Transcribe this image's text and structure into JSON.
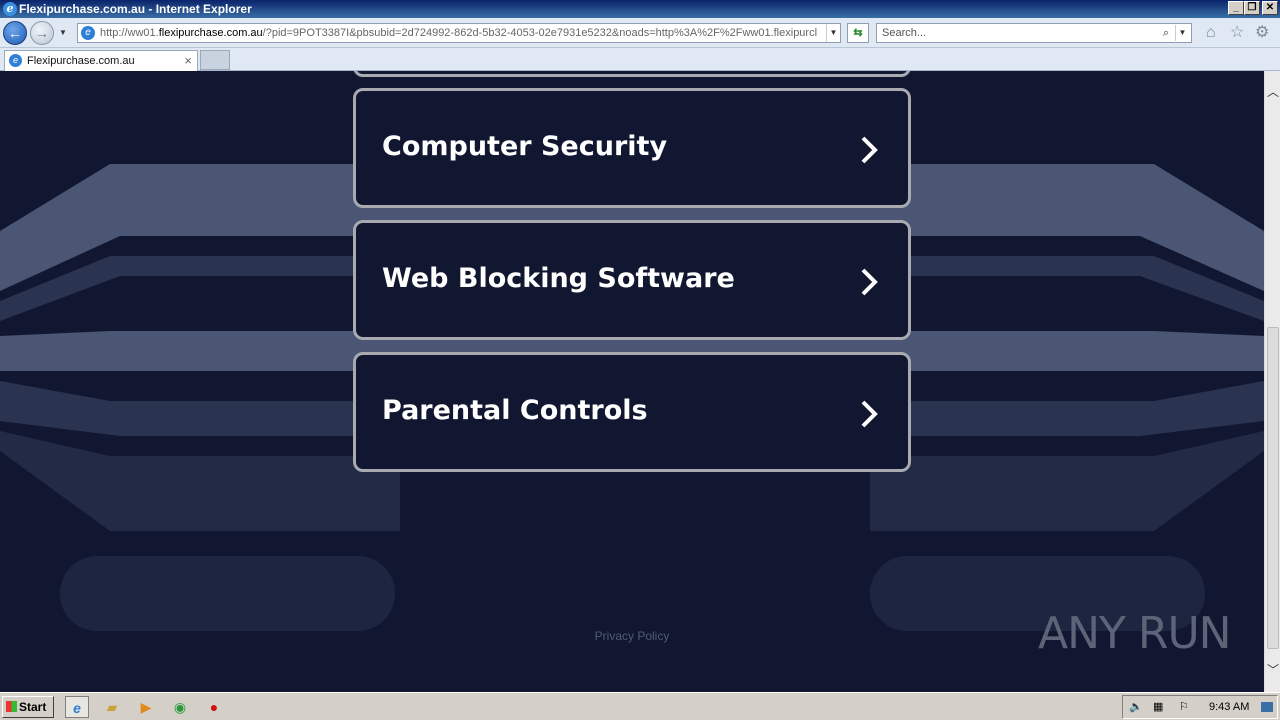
{
  "window": {
    "title": "Flexipurchase.com.au - Internet Explorer"
  },
  "addressbar": {
    "url_prefix": "http://ww01.",
    "url_domain": "flexipurchase.com.au",
    "url_rest": "/?pid=9POT3387I&pbsubid=2d724992-862d-5b32-4053-02e7931e5232&noads=http%3A%2F%2Fww01.flexipurcl"
  },
  "search": {
    "placeholder": "Search..."
  },
  "tabs": [
    {
      "label": "Flexipurchase.com.au"
    }
  ],
  "links": [
    {
      "label": "Computer Security"
    },
    {
      "label": "Web Blocking Software"
    },
    {
      "label": "Parental Controls"
    }
  ],
  "footer": {
    "privacy": "Privacy Policy"
  },
  "watermark": {
    "text": "ANY RUN"
  },
  "taskbar": {
    "start": "Start",
    "clock": "9:43 AM"
  },
  "colors": {
    "page_bg": "#111730",
    "card_border": "#a8aab0",
    "shape_light": "#4a5673",
    "shape_mid": "#2a3350"
  }
}
